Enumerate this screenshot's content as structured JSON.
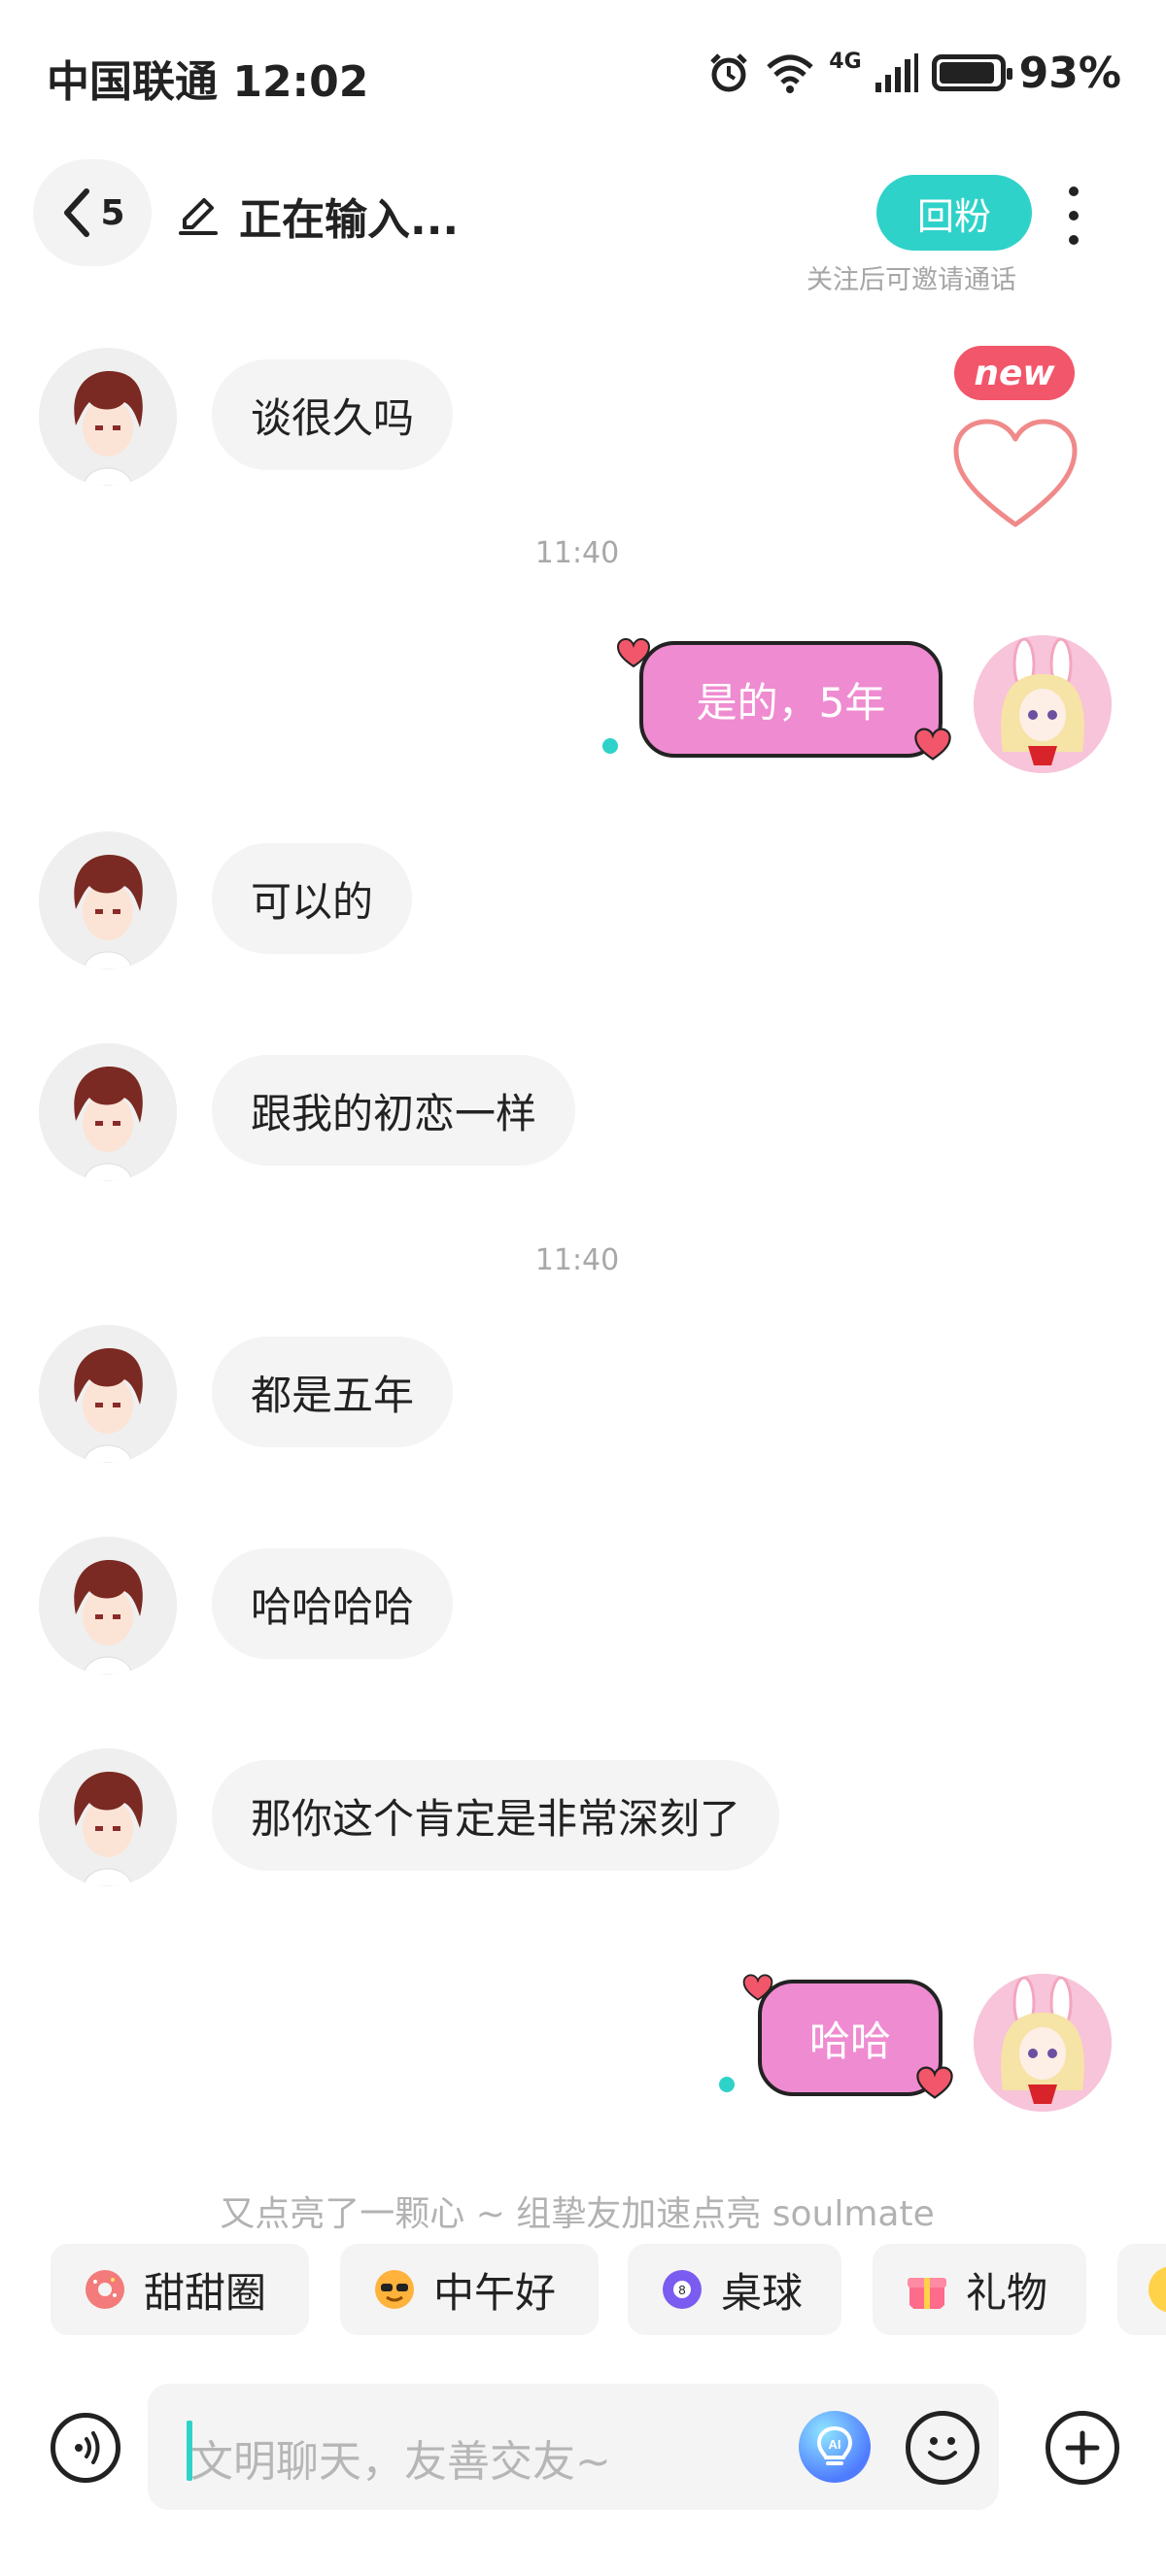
{
  "status_bar": {
    "carrier": "中国联通",
    "time": "12:02",
    "network": "4G",
    "battery_percent_text": "93%",
    "battery_level": 0.93,
    "icons": [
      "alarm-icon",
      "wifi-icon",
      "signal-icon",
      "battery-icon"
    ]
  },
  "header": {
    "back_count": "5",
    "title": "正在输入...",
    "follow_button": "回粉",
    "follow_hint": "关注后可邀请通话",
    "new_badge": "new"
  },
  "messages": [
    {
      "side": "in",
      "text": "谈很久吗"
    },
    {
      "type": "time",
      "text": "11:40"
    },
    {
      "side": "out",
      "text": "是的，5年"
    },
    {
      "side": "in",
      "text": "可以的"
    },
    {
      "side": "in",
      "text": "跟我的初恋一样"
    },
    {
      "type": "time",
      "text": "11:40"
    },
    {
      "side": "in",
      "text": "都是五年"
    },
    {
      "side": "in",
      "text": "哈哈哈哈"
    },
    {
      "side": "in",
      "text": "那你这个肯定是非常深刻了"
    },
    {
      "side": "out",
      "text": "哈哈"
    }
  ],
  "hint_line": "又点亮了一颗心 ~ 组挚友加速点亮 soulmate",
  "quick_actions": [
    {
      "label": "甜甜圈",
      "icon": "donut-icon"
    },
    {
      "label": "中午好",
      "icon": "sunglasses-sun-icon"
    },
    {
      "label": "桌球",
      "icon": "billiard-ball-icon"
    },
    {
      "label": "礼物",
      "icon": "gift-icon"
    }
  ],
  "input": {
    "placeholder": "文明聊天，友善交友~"
  },
  "colors": {
    "accent": "#2fd2c9",
    "outgoing_bubble": "#ef8bd0",
    "incoming_bubble": "#f4f4f4",
    "heart": "#f2566a"
  }
}
